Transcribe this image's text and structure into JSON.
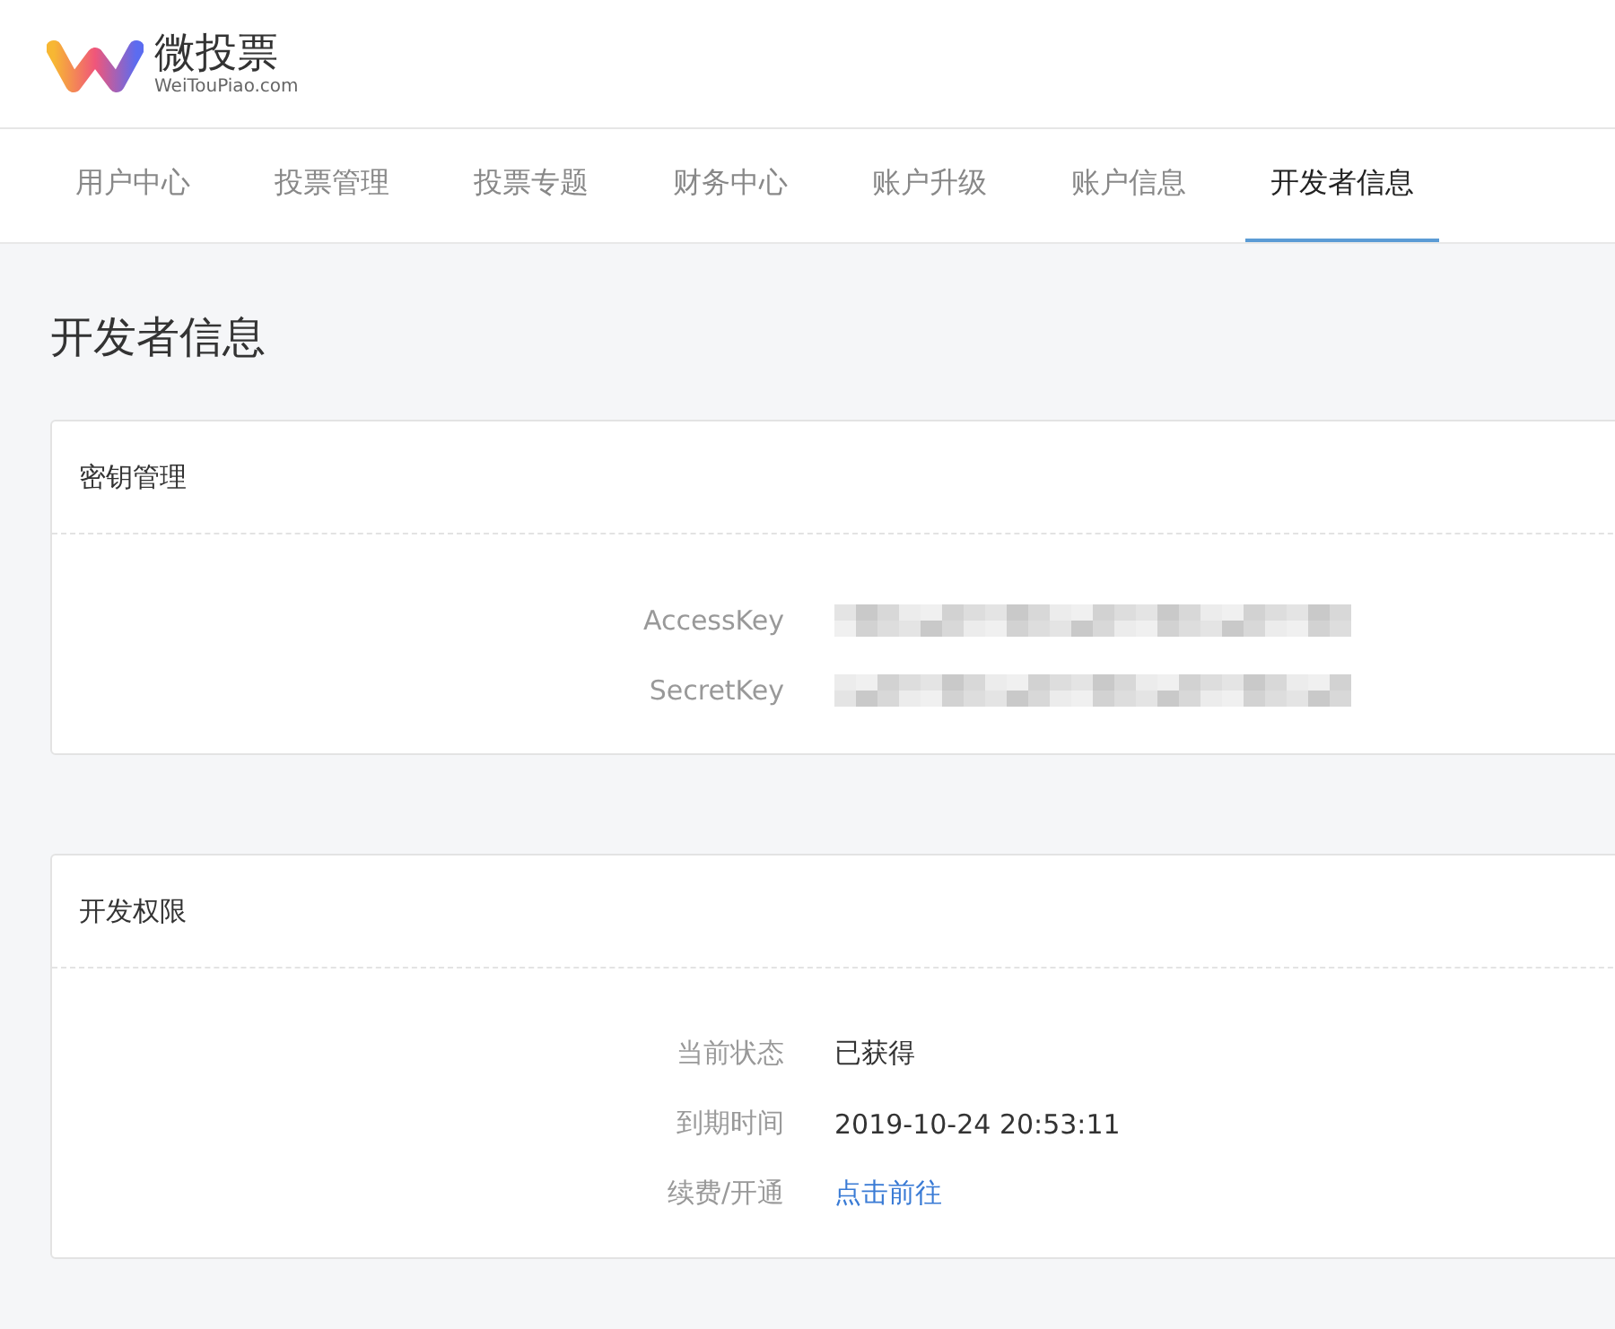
{
  "logo": {
    "name": "微投票",
    "domain": "WeiTouPiao.com"
  },
  "tabs": [
    {
      "label": "用户中心",
      "selected": false
    },
    {
      "label": "投票管理",
      "selected": false
    },
    {
      "label": "投票专题",
      "selected": false
    },
    {
      "label": "财务中心",
      "selected": false
    },
    {
      "label": "账户升级",
      "selected": false
    },
    {
      "label": "账户信息",
      "selected": false
    },
    {
      "label": "开发者信息",
      "selected": true
    }
  ],
  "page_title": "开发者信息",
  "cards": [
    {
      "title": "密钥管理",
      "rows": [
        {
          "label": "AccessKey",
          "kind": "pixelated"
        },
        {
          "label": "SecretKey",
          "kind": "pixelated"
        }
      ]
    },
    {
      "title": "开发权限",
      "rows": [
        {
          "label": "当前状态",
          "kind": "text",
          "value": "已获得"
        },
        {
          "label": "到期时间",
          "kind": "text",
          "value": "2019-10-24 20:53:11"
        },
        {
          "label": "续费/开通",
          "kind": "link",
          "value": "点击前往"
        }
      ]
    }
  ]
}
